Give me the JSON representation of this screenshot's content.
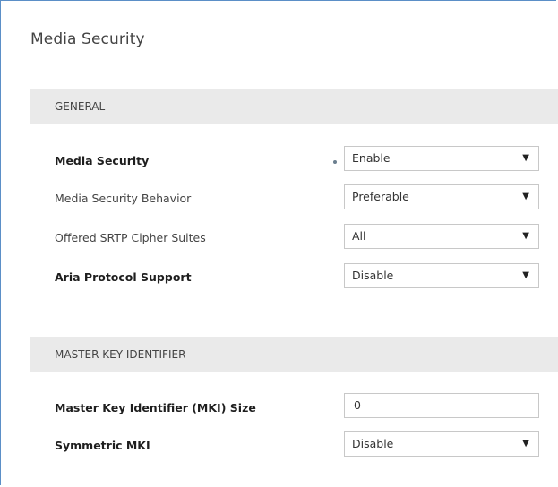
{
  "page": {
    "title": "Media Security"
  },
  "sections": {
    "general": {
      "header": "GENERAL",
      "rows": [
        {
          "label": "Media Security",
          "value": "Enable",
          "modified_indicator": true,
          "caret": "▼"
        },
        {
          "label": "Media Security Behavior",
          "value": "Preferable",
          "caret": "▼"
        },
        {
          "label": "Offered SRTP Cipher Suites",
          "value": "All",
          "caret": "▼"
        },
        {
          "label": "Aria Protocol Support",
          "value": "Disable",
          "caret": "▼"
        }
      ]
    },
    "master_key": {
      "header": "MASTER KEY IDENTIFIER",
      "rows": [
        {
          "label": "Master Key Identifier (MKI) Size",
          "value": "0"
        },
        {
          "label": "Symmetric MKI",
          "value": "Disable",
          "caret": "▼"
        }
      ]
    }
  },
  "colors": {
    "panel_border": "#5b8fc7",
    "section_background": "#eaeaea",
    "field_border": "#c8c8c8"
  }
}
